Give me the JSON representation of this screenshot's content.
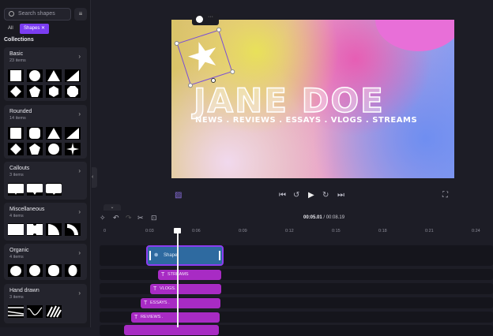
{
  "sidebar": {
    "search_placeholder": "Search shapes",
    "filter_all": "All",
    "chip": "Shapes",
    "chip_close": "✕",
    "collections_title": "Collections",
    "collections": [
      {
        "name": "Basic",
        "count": "23 items"
      },
      {
        "name": "Rounded",
        "count": "14 items"
      },
      {
        "name": "Callouts",
        "count": "3 items"
      },
      {
        "name": "Miscellaneous",
        "count": "4 items"
      },
      {
        "name": "Organic",
        "count": "4 items"
      },
      {
        "name": "Hand drawn",
        "count": "3 items"
      }
    ]
  },
  "canvas": {
    "title": "JANE DOE",
    "subtitle": "NEWS . REVIEWS . ESSAYS . VLOGS . STREAMS",
    "more": "···"
  },
  "timeline": {
    "current": "00:05.01",
    "total": "/ 00:08.19",
    "ticks": [
      "0",
      "0:03",
      "0:06",
      "0:09",
      "0:12",
      "0:15",
      "0:18",
      "0:21",
      "0:24"
    ],
    "shape_clip": "Shape",
    "text_clips": [
      "STREAMS",
      "VLOGS.",
      "ESSAYS .",
      "REVIEWS ."
    ]
  },
  "colors": {
    "accent": "#7b3df2",
    "text_clip": "#a82bc4",
    "shape_clip": "#2e6aa0"
  }
}
